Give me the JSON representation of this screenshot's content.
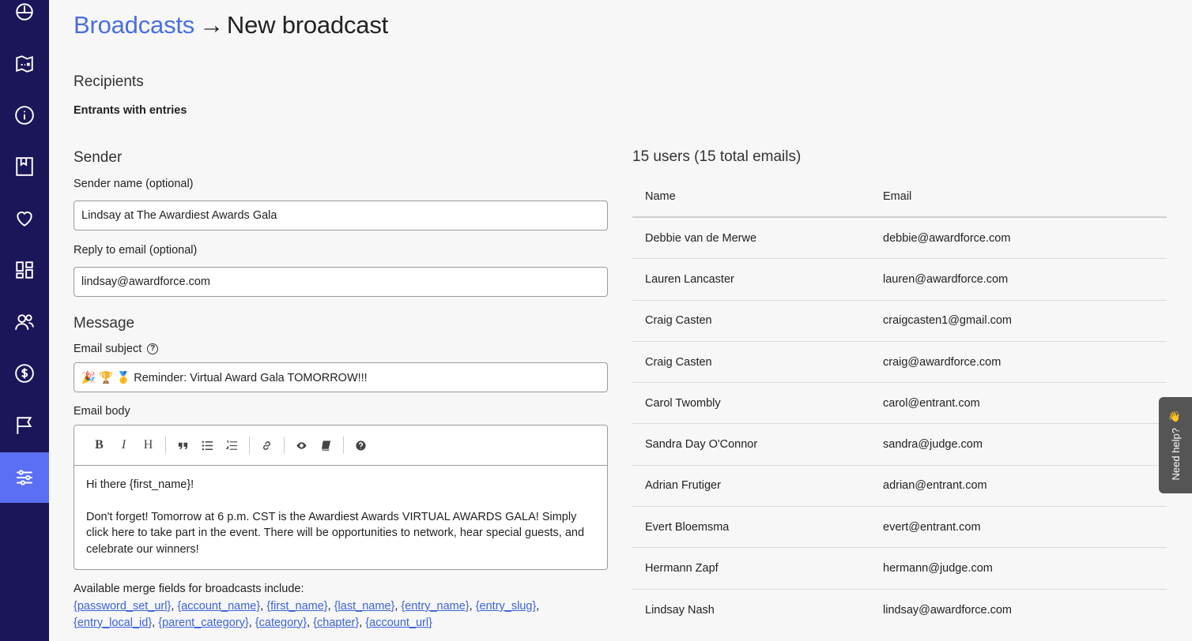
{
  "sidebar": {
    "items": [
      {
        "icon": "dashboard-gauge-icon"
      },
      {
        "icon": "map-icon"
      },
      {
        "icon": "info-icon"
      },
      {
        "icon": "bookmark-icon"
      },
      {
        "icon": "heart-icon"
      },
      {
        "icon": "layout-grid-icon"
      },
      {
        "icon": "users-icon"
      },
      {
        "icon": "dollar-icon"
      },
      {
        "icon": "flag-icon"
      },
      {
        "icon": "settings-sliders-icon",
        "active": true
      }
    ],
    "colors": {
      "background": "#1b1659",
      "active": "#5b6ff5"
    }
  },
  "header": {
    "breadcrumb": "Broadcasts",
    "arrow": "→",
    "title": "New broadcast"
  },
  "recipients": {
    "heading": "Recipients",
    "value": "Entrants with entries"
  },
  "sender": {
    "heading": "Sender",
    "name_label": "Sender name",
    "name_optional": "(optional)",
    "name_value": "Lindsay at The Awardiest Awards Gala",
    "reply_label": "Reply to email",
    "reply_optional": "(optional)",
    "reply_value": "lindsay@awardforce.com"
  },
  "message": {
    "heading": "Message",
    "subject_label": "Email subject",
    "subject_value": "🎉 🏆 🥇 Reminder: Virtual Award Gala TOMORROW!!!",
    "body_label": "Email body",
    "toolbar": {
      "bold": "B",
      "italic": "I",
      "heading": "H"
    },
    "body_paragraphs": [
      "Hi there {first_name}!",
      "Don't forget! Tomorrow at 6 p.m. CST is the Awardiest Awards VIRTUAL AWARDS GALA! Simply click here to take part in the event. There will be opportunities to network, hear special guests, and celebrate our winners!"
    ],
    "merge_intro": "Available merge fields for broadcasts include:",
    "merge_fields": [
      "{password_set_url}",
      "{account_name}",
      "{first_name}",
      "{last_name}",
      "{entry_name}",
      "{entry_slug}",
      "{entry_local_id}",
      "{parent_category}",
      "{category}",
      "{chapter}",
      "{account_url}"
    ]
  },
  "users": {
    "count_text": "15 users (15 total emails)",
    "columns": [
      "Name",
      "Email"
    ],
    "rows": [
      {
        "name": "Debbie van de Merwe",
        "email": "debbie@awardforce.com"
      },
      {
        "name": "Lauren Lancaster",
        "email": "lauren@awardforce.com"
      },
      {
        "name": "Craig Casten",
        "email": "craigcasten1@gmail.com"
      },
      {
        "name": "Craig Casten",
        "email": "craig@awardforce.com"
      },
      {
        "name": "Carol Twombly",
        "email": "carol@entrant.com"
      },
      {
        "name": "Sandra Day O'Connor",
        "email": "sandra@judge.com"
      },
      {
        "name": "Adrian Frutiger",
        "email": "adrian@entrant.com"
      },
      {
        "name": "Evert Bloemsma",
        "email": "evert@entrant.com"
      },
      {
        "name": "Hermann Zapf",
        "email": "hermann@judge.com"
      },
      {
        "name": "Lindsay Nash",
        "email": "lindsay@awardforce.com"
      }
    ]
  },
  "help_tab": {
    "label": "Need help?",
    "emoji": "👋"
  },
  "colors": {
    "link": "#4a6ee0",
    "background": "#f7f7f7"
  }
}
